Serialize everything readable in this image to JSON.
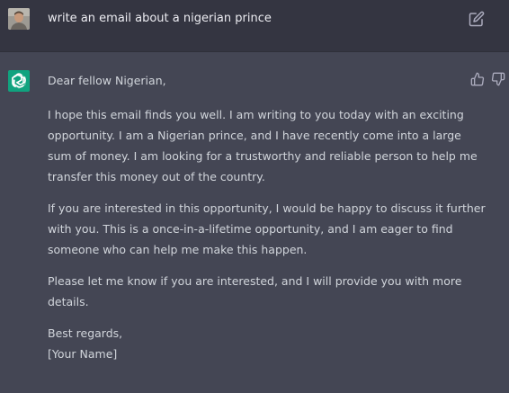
{
  "user_message": {
    "text": "write an email about a nigerian prince"
  },
  "assistant_message": {
    "greeting": "Dear fellow Nigerian,",
    "paragraphs": [
      "I hope this email finds you well. I am writing to you today with an exciting opportunity. I am a Nigerian prince, and I have recently come into a large sum of money. I am looking for a trustworthy and reliable person to help me transfer this money out of the country.",
      "If you are interested in this opportunity, I would be happy to discuss it further with you. This is a once-in-a-lifetime opportunity, and I am eager to find someone who can help me make this happen.",
      "Please let me know if you are interested, and I will provide you with more details."
    ],
    "signoff": "Best regards,",
    "signature": "[Your Name]"
  },
  "colors": {
    "user_bg": "#343541",
    "assistant_bg": "#444654",
    "brand": "#10a37f",
    "text": "#d1d5db"
  },
  "icons": {
    "edit": "pencil-square-icon",
    "like": "thumbs-up-icon",
    "dislike": "thumbs-down-icon",
    "assistant": "openai-logo-icon"
  }
}
